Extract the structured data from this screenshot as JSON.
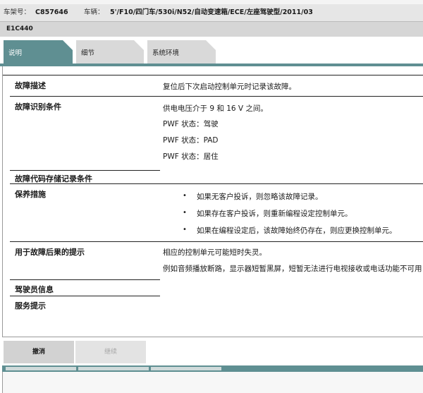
{
  "header": {
    "vin_label": "车架号：",
    "vin_value": "C857646",
    "vehicle_label": "车辆：",
    "vehicle_value": "5'/F10/四门车/530i/N52/自动变速箱/ECE/左座驾驶型/2011/03"
  },
  "fault_code": "E1C440",
  "tabs": [
    {
      "label": "说明",
      "active": true
    },
    {
      "label": "细节",
      "active": false
    },
    {
      "label": "系统环境",
      "active": false
    }
  ],
  "content": {
    "description": {
      "label": "故障描述",
      "text": "复位后下次启动控制单元时记录该故障。"
    },
    "conditions": {
      "label": "故障识别条件",
      "lines": [
        "供电电压介于  9 和  16 V 之间。",
        "PWF 状态：驾驶",
        "PWF 状态：PAD",
        "PWF 状态：居住"
      ]
    },
    "storage": {
      "label": "故障代码存储记录条件"
    },
    "maintenance": {
      "label": "保养措施",
      "bullets": [
        "如果无客户投诉，则忽略该故障记录。",
        "如果存在客户投诉，则重新编程设定控制单元。",
        "如果在编程设定后，该故障始终仍存在，则应更换控制单元。"
      ]
    },
    "consequence": {
      "label": "用于故障后果的提示",
      "lines": [
        "相应的控制单元可能短时失灵。",
        "例如音频播放断路，显示器短暂黑屏，短暂无法进行电视接收或电话功能不可用"
      ]
    },
    "driver_info": {
      "label": "驾驶员信息"
    },
    "service_hint": {
      "label": "服务提示"
    }
  },
  "buttons": {
    "cancel": "撤消",
    "second": "继续"
  },
  "colors": {
    "accent": "#5f8f92",
    "tab_inactive": "#d9d9d9",
    "header_bg": "#e6e6e6",
    "code_bar_bg": "#d6d6d6",
    "button_bg": "#d2d2d2"
  }
}
